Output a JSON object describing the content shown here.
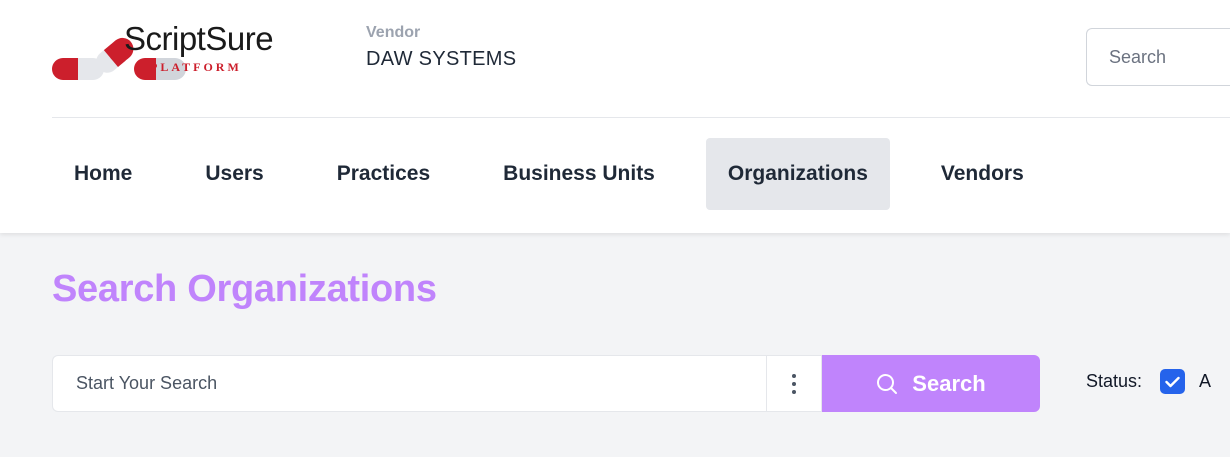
{
  "brand": {
    "name": "ScriptSure",
    "subtitle": "PLATFORM",
    "colors": {
      "red": "#cc1f2c",
      "dark": "#1a1a1a",
      "gray": "#d1d5db"
    }
  },
  "vendor": {
    "label": "Vendor",
    "name": "DAW SYSTEMS"
  },
  "top_search": {
    "placeholder": "Search"
  },
  "nav": {
    "items": [
      {
        "label": "Home",
        "active": false
      },
      {
        "label": "Users",
        "active": false
      },
      {
        "label": "Practices",
        "active": false
      },
      {
        "label": "Business Units",
        "active": false
      },
      {
        "label": "Organizations",
        "active": true
      },
      {
        "label": "Vendors",
        "active": false
      }
    ]
  },
  "main": {
    "title": "Search Organizations",
    "search": {
      "placeholder": "Start Your Search",
      "button_label": "Search",
      "button_icon": "search-icon",
      "options_icon": "kebab-icon"
    },
    "status": {
      "label": "Status:",
      "checked": true,
      "option_visible": "A"
    }
  },
  "colors": {
    "accent": "#c084fc",
    "checkbox": "#2563eb",
    "nav_active_bg": "#e5e7eb",
    "page_bg": "#f3f4f6"
  }
}
